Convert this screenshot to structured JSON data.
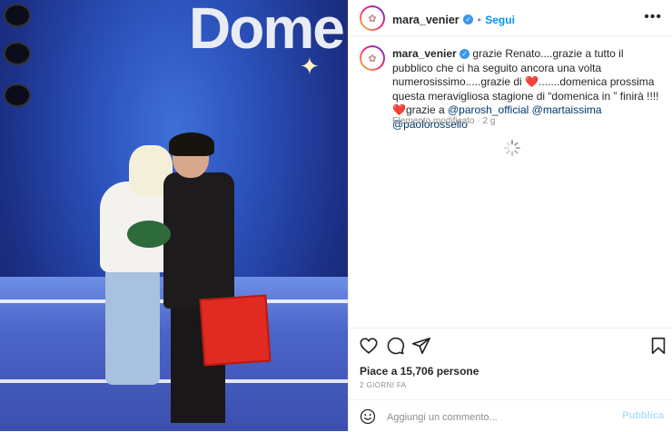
{
  "post": {
    "username": "mara_venier",
    "follow_label": "Segui",
    "separator": "•",
    "more_icon": "more-icon",
    "caption": {
      "username": "mara_venier",
      "part1": "grazie Renato....grazie a tutto il pubblico che ci ha seguito ancora una volta numerosissimo.....grazie di ",
      "heart1": "❤️",
      "part2": ".......domenica prossima questa meravigliosa stagione di “domenica in ” finirà !!!!",
      "heart2": "❤️",
      "part3": "grazie a ",
      "mention1": "@parosh_official",
      "mention2": "@martaissima",
      "mention3": "@paolorossello"
    },
    "edited_label": "Elemento modificato",
    "edited_time": "2 g",
    "likes_label": "Piace a 15,706 persone",
    "time_label": "2 GIORNI FA",
    "comment_placeholder": "Aggiungi un commento...",
    "publish_label": "Pubblica"
  },
  "photo": {
    "logo_text": "Dome"
  },
  "colors": {
    "accent": "#0095f6",
    "verified": "#3897f0",
    "mention": "#00376b",
    "muted": "#8e8e8e",
    "publish_disabled": "#b2dffc"
  },
  "icons": [
    "verified-icon",
    "heart-icon",
    "comment-icon",
    "share-icon",
    "bookmark-icon",
    "emoji-icon",
    "loading-spinner-icon",
    "more-icon"
  ]
}
